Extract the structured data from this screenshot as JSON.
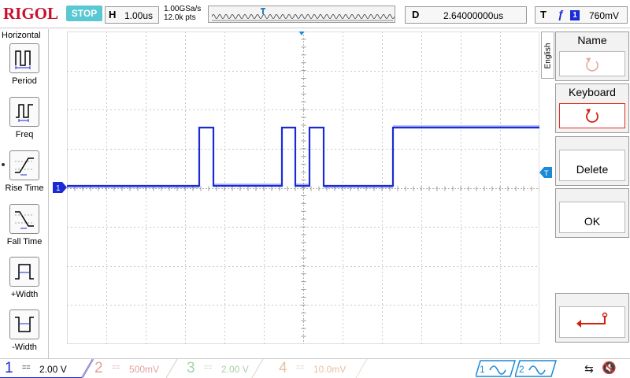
{
  "topbar": {
    "logo": "RIGOL",
    "run_state": "STOP",
    "horizontal_label": "H",
    "timebase": "1.00us",
    "sample_rate": "1.00GSa/s",
    "memory_depth": "12.0k pts",
    "delay_label": "D",
    "delay_value": "2.64000000us",
    "trigger_label": "T",
    "trigger_source": "1",
    "trigger_level": "760mV"
  },
  "left_menu": {
    "title": "Horizontal",
    "items": [
      {
        "label": "Period",
        "icon": "period-icon"
      },
      {
        "label": "Freq",
        "icon": "freq-icon"
      },
      {
        "label": "Rise Time",
        "icon": "rise-time-icon"
      },
      {
        "label": "Fall Time",
        "icon": "fall-time-icon"
      },
      {
        "label": "+Width",
        "icon": "plus-width-icon"
      },
      {
        "label": "-Width",
        "icon": "minus-width-icon"
      }
    ]
  },
  "markers": {
    "channel1": "1",
    "trigger": "T"
  },
  "right_menu": {
    "language_tab": "English",
    "name_label": "Name",
    "keyboard_label": "Keyboard",
    "delete_label": "Delete",
    "ok_label": "OK"
  },
  "bottom_bar": {
    "channels": [
      {
        "number": "1",
        "coupling": "==",
        "scale": "2.00 V",
        "color": "#1a2bd6"
      },
      {
        "number": "2",
        "coupling": "==",
        "scale": "500mV",
        "color": "#e4a0a0"
      },
      {
        "number": "3",
        "coupling": "==",
        "scale": "2.00 V",
        "color": "#a8d0a8"
      },
      {
        "number": "4",
        "coupling": "==",
        "scale": "10.0mV",
        "color": "#e8c0a0"
      }
    ],
    "math1": "1",
    "math2": "2"
  },
  "colors": {
    "trace": "#1a2bd6",
    "accent": "#5ac8d2",
    "logo": "#c8102e",
    "active_border": "#e03020"
  }
}
